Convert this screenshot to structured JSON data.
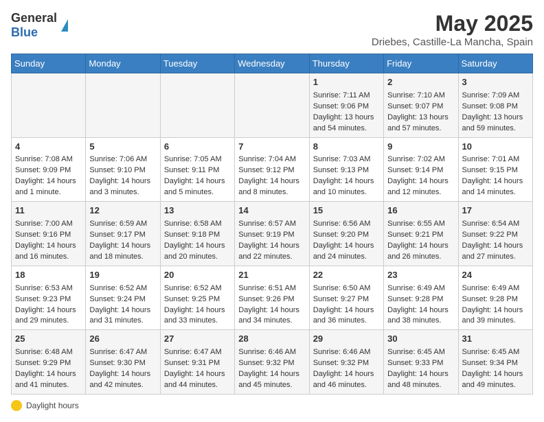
{
  "header": {
    "logo_general": "General",
    "logo_blue": "Blue",
    "month_title": "May 2025",
    "location": "Driebes, Castille-La Mancha, Spain"
  },
  "days_of_week": [
    "Sunday",
    "Monday",
    "Tuesday",
    "Wednesday",
    "Thursday",
    "Friday",
    "Saturday"
  ],
  "footer": {
    "label": "Daylight hours"
  },
  "weeks": [
    {
      "days": [
        {
          "num": "",
          "content": ""
        },
        {
          "num": "",
          "content": ""
        },
        {
          "num": "",
          "content": ""
        },
        {
          "num": "",
          "content": ""
        },
        {
          "num": "1",
          "content": "Sunrise: 7:11 AM\nSunset: 9:06 PM\nDaylight: 13 hours\nand 54 minutes."
        },
        {
          "num": "2",
          "content": "Sunrise: 7:10 AM\nSunset: 9:07 PM\nDaylight: 13 hours\nand 57 minutes."
        },
        {
          "num": "3",
          "content": "Sunrise: 7:09 AM\nSunset: 9:08 PM\nDaylight: 13 hours\nand 59 minutes."
        }
      ]
    },
    {
      "days": [
        {
          "num": "4",
          "content": "Sunrise: 7:08 AM\nSunset: 9:09 PM\nDaylight: 14 hours\nand 1 minute."
        },
        {
          "num": "5",
          "content": "Sunrise: 7:06 AM\nSunset: 9:10 PM\nDaylight: 14 hours\nand 3 minutes."
        },
        {
          "num": "6",
          "content": "Sunrise: 7:05 AM\nSunset: 9:11 PM\nDaylight: 14 hours\nand 5 minutes."
        },
        {
          "num": "7",
          "content": "Sunrise: 7:04 AM\nSunset: 9:12 PM\nDaylight: 14 hours\nand 8 minutes."
        },
        {
          "num": "8",
          "content": "Sunrise: 7:03 AM\nSunset: 9:13 PM\nDaylight: 14 hours\nand 10 minutes."
        },
        {
          "num": "9",
          "content": "Sunrise: 7:02 AM\nSunset: 9:14 PM\nDaylight: 14 hours\nand 12 minutes."
        },
        {
          "num": "10",
          "content": "Sunrise: 7:01 AM\nSunset: 9:15 PM\nDaylight: 14 hours\nand 14 minutes."
        }
      ]
    },
    {
      "days": [
        {
          "num": "11",
          "content": "Sunrise: 7:00 AM\nSunset: 9:16 PM\nDaylight: 14 hours\nand 16 minutes."
        },
        {
          "num": "12",
          "content": "Sunrise: 6:59 AM\nSunset: 9:17 PM\nDaylight: 14 hours\nand 18 minutes."
        },
        {
          "num": "13",
          "content": "Sunrise: 6:58 AM\nSunset: 9:18 PM\nDaylight: 14 hours\nand 20 minutes."
        },
        {
          "num": "14",
          "content": "Sunrise: 6:57 AM\nSunset: 9:19 PM\nDaylight: 14 hours\nand 22 minutes."
        },
        {
          "num": "15",
          "content": "Sunrise: 6:56 AM\nSunset: 9:20 PM\nDaylight: 14 hours\nand 24 minutes."
        },
        {
          "num": "16",
          "content": "Sunrise: 6:55 AM\nSunset: 9:21 PM\nDaylight: 14 hours\nand 26 minutes."
        },
        {
          "num": "17",
          "content": "Sunrise: 6:54 AM\nSunset: 9:22 PM\nDaylight: 14 hours\nand 27 minutes."
        }
      ]
    },
    {
      "days": [
        {
          "num": "18",
          "content": "Sunrise: 6:53 AM\nSunset: 9:23 PM\nDaylight: 14 hours\nand 29 minutes."
        },
        {
          "num": "19",
          "content": "Sunrise: 6:52 AM\nSunset: 9:24 PM\nDaylight: 14 hours\nand 31 minutes."
        },
        {
          "num": "20",
          "content": "Sunrise: 6:52 AM\nSunset: 9:25 PM\nDaylight: 14 hours\nand 33 minutes."
        },
        {
          "num": "21",
          "content": "Sunrise: 6:51 AM\nSunset: 9:26 PM\nDaylight: 14 hours\nand 34 minutes."
        },
        {
          "num": "22",
          "content": "Sunrise: 6:50 AM\nSunset: 9:27 PM\nDaylight: 14 hours\nand 36 minutes."
        },
        {
          "num": "23",
          "content": "Sunrise: 6:49 AM\nSunset: 9:28 PM\nDaylight: 14 hours\nand 38 minutes."
        },
        {
          "num": "24",
          "content": "Sunrise: 6:49 AM\nSunset: 9:28 PM\nDaylight: 14 hours\nand 39 minutes."
        }
      ]
    },
    {
      "days": [
        {
          "num": "25",
          "content": "Sunrise: 6:48 AM\nSunset: 9:29 PM\nDaylight: 14 hours\nand 41 minutes."
        },
        {
          "num": "26",
          "content": "Sunrise: 6:47 AM\nSunset: 9:30 PM\nDaylight: 14 hours\nand 42 minutes."
        },
        {
          "num": "27",
          "content": "Sunrise: 6:47 AM\nSunset: 9:31 PM\nDaylight: 14 hours\nand 44 minutes."
        },
        {
          "num": "28",
          "content": "Sunrise: 6:46 AM\nSunset: 9:32 PM\nDaylight: 14 hours\nand 45 minutes."
        },
        {
          "num": "29",
          "content": "Sunrise: 6:46 AM\nSunset: 9:32 PM\nDaylight: 14 hours\nand 46 minutes."
        },
        {
          "num": "30",
          "content": "Sunrise: 6:45 AM\nSunset: 9:33 PM\nDaylight: 14 hours\nand 48 minutes."
        },
        {
          "num": "31",
          "content": "Sunrise: 6:45 AM\nSunset: 9:34 PM\nDaylight: 14 hours\nand 49 minutes."
        }
      ]
    }
  ]
}
